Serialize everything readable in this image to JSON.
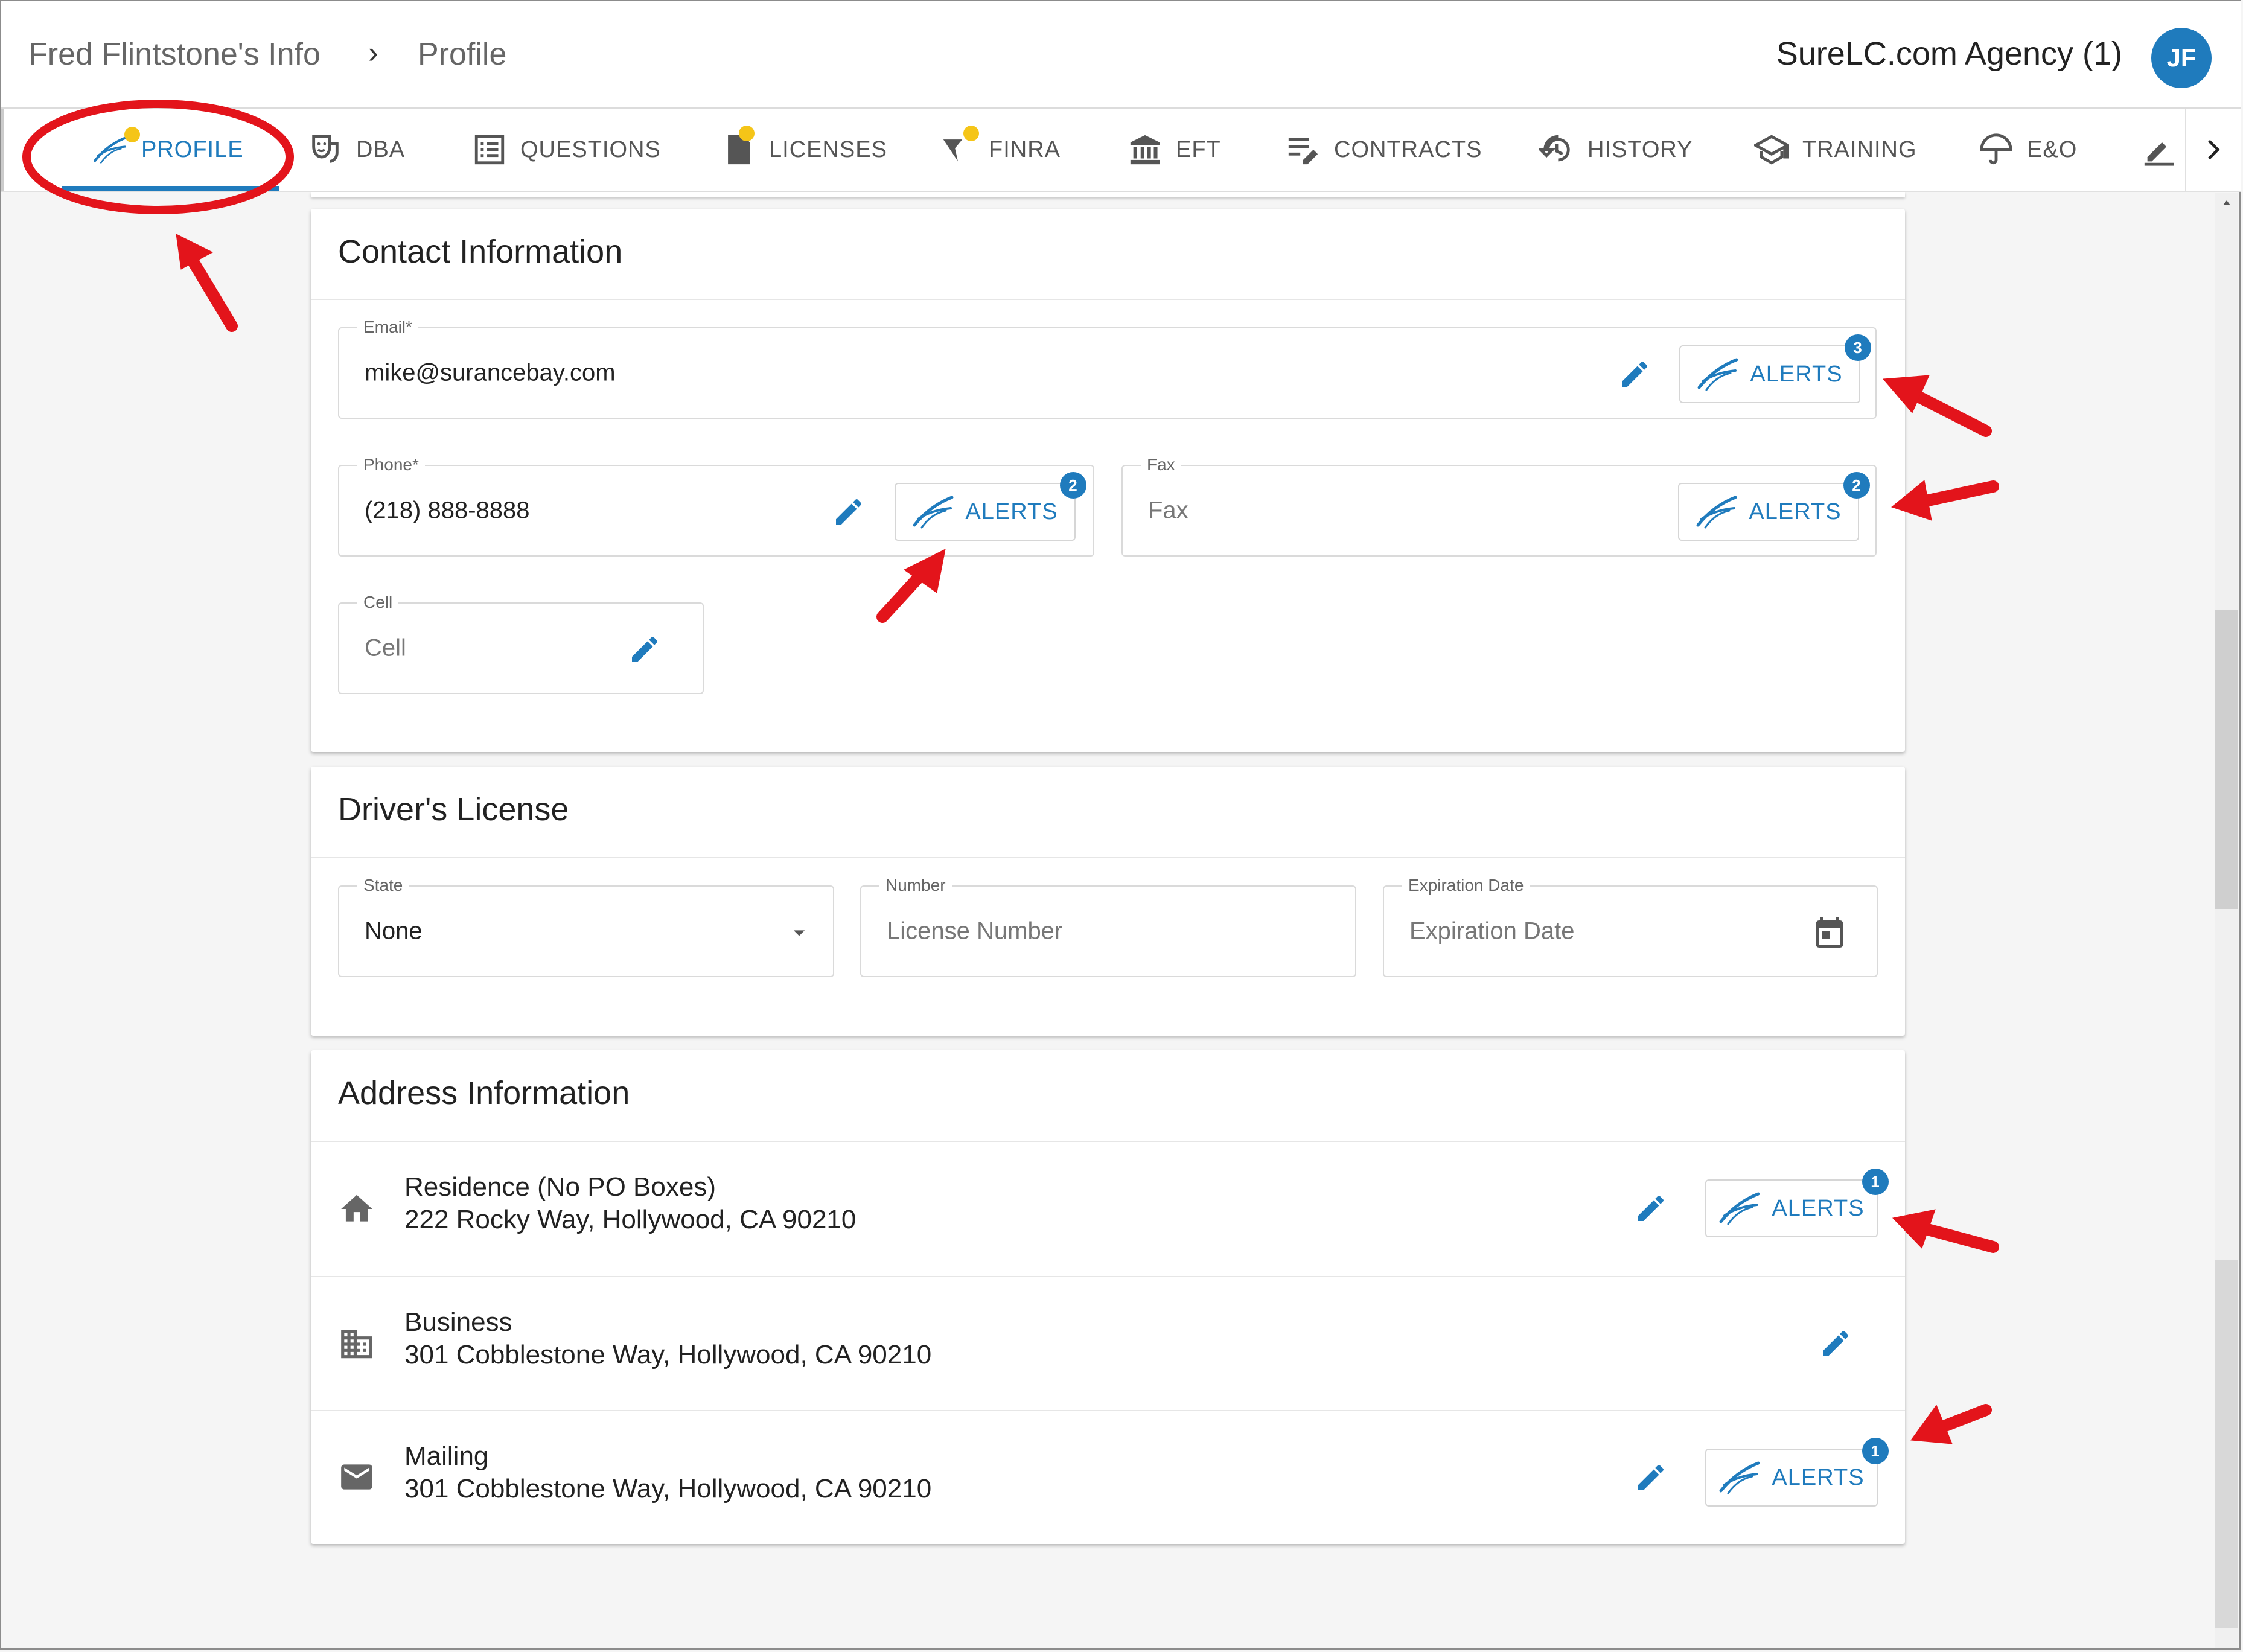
{
  "breadcrumb": {
    "parent": "Fred Flintstone's Info",
    "separator": "›",
    "current": "Profile"
  },
  "header": {
    "agency": "SureLC.com Agency (1)",
    "avatar_initials": "JF"
  },
  "tabs": [
    {
      "label": "PROFILE",
      "icon": "surelc-swoosh-icon",
      "active": true,
      "dot": true
    },
    {
      "label": "DBA",
      "icon": "theater-masks-icon"
    },
    {
      "label": "QUESTIONS",
      "icon": "list-icon"
    },
    {
      "label": "LICENSES",
      "icon": "document-icon",
      "dot": true
    },
    {
      "label": "FINRA",
      "icon": "finra-icon",
      "dot": true
    },
    {
      "label": "EFT",
      "icon": "bank-icon"
    },
    {
      "label": "CONTRACTS",
      "icon": "edit-list-icon"
    },
    {
      "label": "HISTORY",
      "icon": "history-icon"
    },
    {
      "label": "TRAINING",
      "icon": "school-icon"
    },
    {
      "label": "E&O",
      "icon": "umbrella-icon"
    }
  ],
  "contact": {
    "title": "Contact Information",
    "email": {
      "label": "Email*",
      "value": "mike@surancebay.com",
      "alerts_label": "ALERTS",
      "alerts_count": "3"
    },
    "phone": {
      "label": "Phone*",
      "value": "(218) 888-8888",
      "alerts_label": "ALERTS",
      "alerts_count": "2"
    },
    "fax": {
      "label": "Fax",
      "placeholder": "Fax",
      "alerts_label": "ALERTS",
      "alerts_count": "2"
    },
    "cell": {
      "label": "Cell",
      "placeholder": "Cell"
    }
  },
  "drivers_license": {
    "title": "Driver's License",
    "state": {
      "label": "State",
      "value": "None"
    },
    "number": {
      "label": "Number",
      "placeholder": "License Number"
    },
    "expiration": {
      "label": "Expiration Date",
      "placeholder": "Expiration Date"
    }
  },
  "address": {
    "title": "Address Information",
    "rows": [
      {
        "type": "Residence (No PO Boxes)",
        "line": "222 Rocky Way, Hollywood, CA 90210",
        "icon": "home-icon",
        "alerts_label": "ALERTS",
        "alerts_count": "1"
      },
      {
        "type": "Business",
        "line": "301 Cobblestone Way, Hollywood, CA 90210",
        "icon": "business-icon"
      },
      {
        "type": "Mailing",
        "line": "301 Cobblestone Way, Hollywood, CA 90210",
        "icon": "mail-icon",
        "alerts_label": "ALERTS",
        "alerts_count": "1"
      }
    ]
  },
  "colors": {
    "accent": "#1f7bbd",
    "annotation": "#e3141b",
    "dot": "#f5c518"
  }
}
